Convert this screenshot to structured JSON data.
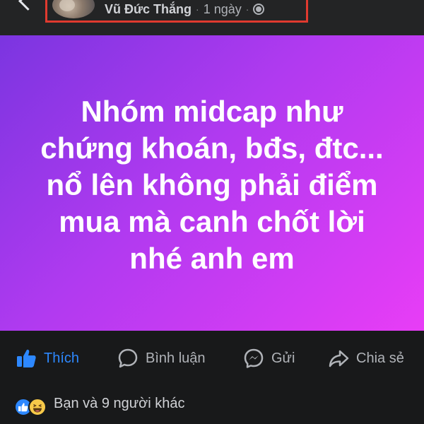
{
  "header": {
    "author_name": "Vũ Đức Thắng",
    "separator": "·",
    "time": "1 ngày",
    "privacy_icon": "globe-icon",
    "highlight_color": "#e03a2f"
  },
  "post": {
    "text_lines": [
      "Nhóm midcap như",
      "chứng khoán, bđs, đtc...",
      "nổ lên không phải điểm",
      "mua mà canh chốt lời",
      "nhé anh em"
    ],
    "background_gradient": [
      "#7b35e0",
      "#e83df6"
    ]
  },
  "actions": {
    "like": {
      "label": "Thích",
      "icon": "like-icon",
      "color": "#2d88ff"
    },
    "comment": {
      "label": "Bình luận",
      "icon": "comment-icon"
    },
    "send": {
      "label": "Gửi",
      "icon": "messenger-icon"
    },
    "share": {
      "label": "Chia sẻ",
      "icon": "share-icon"
    }
  },
  "reactions": {
    "icons": [
      "like-reaction-icon",
      "haha-reaction-icon"
    ],
    "summary": "Bạn và 9 người khác"
  }
}
